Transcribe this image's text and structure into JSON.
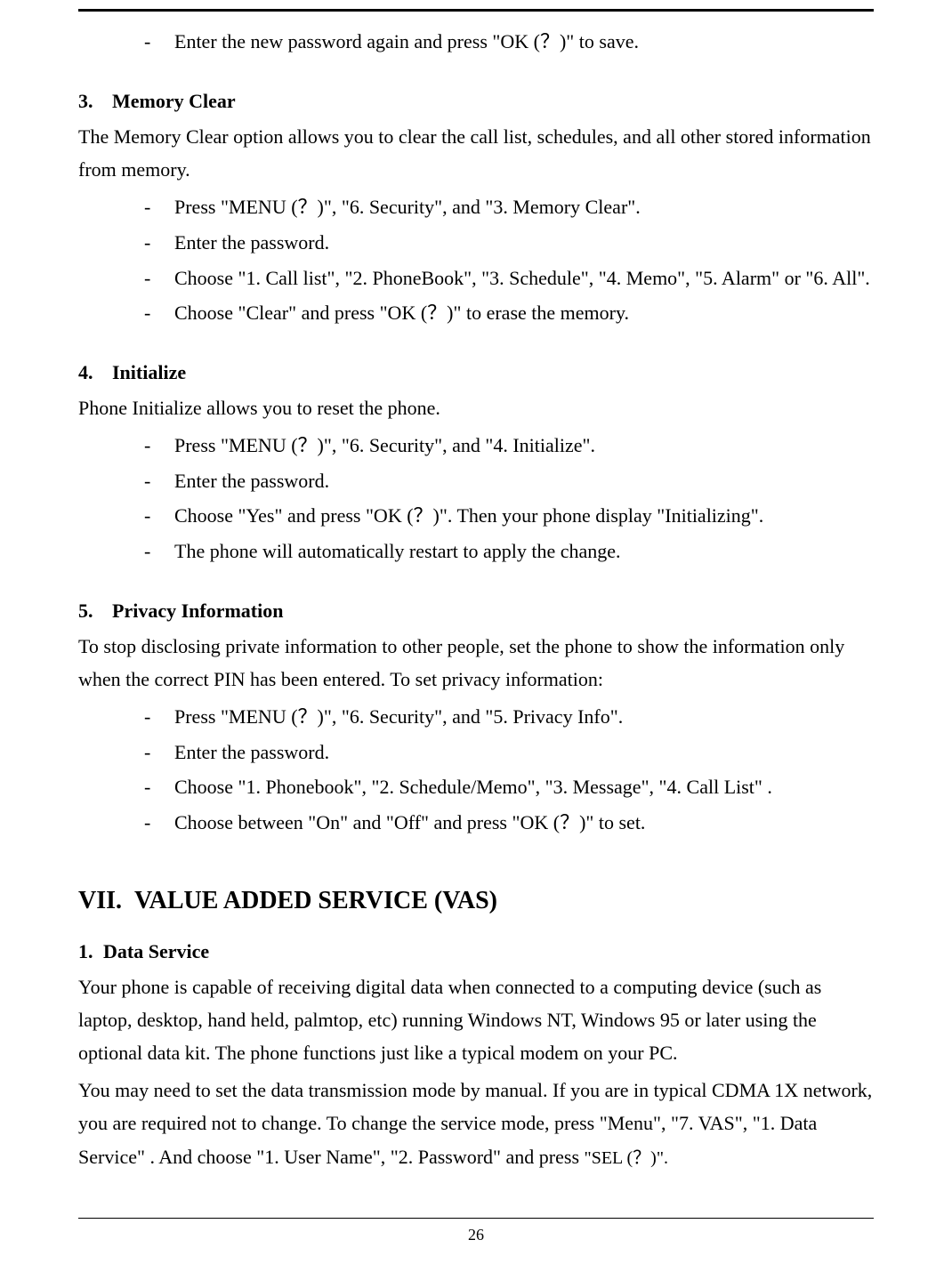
{
  "bulletTop": "Enter the new password again and press \"OK (？)\" to save.",
  "sec3": {
    "num": "3.",
    "title": "Memory Clear",
    "desc": "The Memory Clear option allows you to clear the call list, schedules, and all other stored information from memory.",
    "items": [
      "Press \"MENU (？)\", \"6. Security\", and \"3. Memory Clear\".",
      "Enter the password.",
      "Choose \"1. Call list\", \"2. PhoneBook\", \"3. Schedule\", \"4. Memo\", \"5. Alarm\" or \"6. All\".",
      "Choose \"Clear\" and press \"OK (？)\" to erase the memory."
    ]
  },
  "sec4": {
    "num": "4.",
    "title": "Initialize",
    "desc": "Phone Initialize allows you to reset the phone.",
    "items": [
      "Press \"MENU (？)\", \"6. Security\", and \"4. Initialize\".",
      "Enter the password.",
      "Choose \"Yes\" and press \"OK (？)\". Then your phone display \"Initializing\".",
      "The phone will automatically restart to apply the change."
    ]
  },
  "sec5": {
    "num": "5.",
    "title": "Privacy Information",
    "desc": "To stop disclosing private information to other people, set the phone to show the information only when the correct PIN has been entered.   To set privacy information:",
    "items": [
      "Press \"MENU (？)\", \"6. Security\", and \"5. Privacy Info\".",
      "Enter the password.",
      "Choose \"1. Phonebook\", \"2. Schedule/Memo\", \"3. Message\", \"4. Call List\" .",
      "Choose between \"On\" and \"Off\" and press \"OK (？)\" to set."
    ]
  },
  "major": {
    "num": "VII.",
    "title": "VALUE ADDED SERVICE (VAS)"
  },
  "sub1": {
    "num": "1.",
    "title": "Data Service",
    "p1": "Your phone is capable of receiving digital data when connected to a computing device (such as laptop, desktop, hand held, palmtop, etc) running Windows NT, Windows 95 or later using the optional data kit. The phone functions just like a typical modem on your PC.",
    "p2a": "You may need to set the data transmission mode by manual. If you are in typical CDMA 1X network, you are required not to change. To change the service mode, press \"Menu\", \"7. VAS\", \"1. Data Service\" . And choose \"1. User Name\", \"2. Password\" and press ",
    "p2b": "\"SEL (？)\"."
  },
  "pageNumber": "26"
}
